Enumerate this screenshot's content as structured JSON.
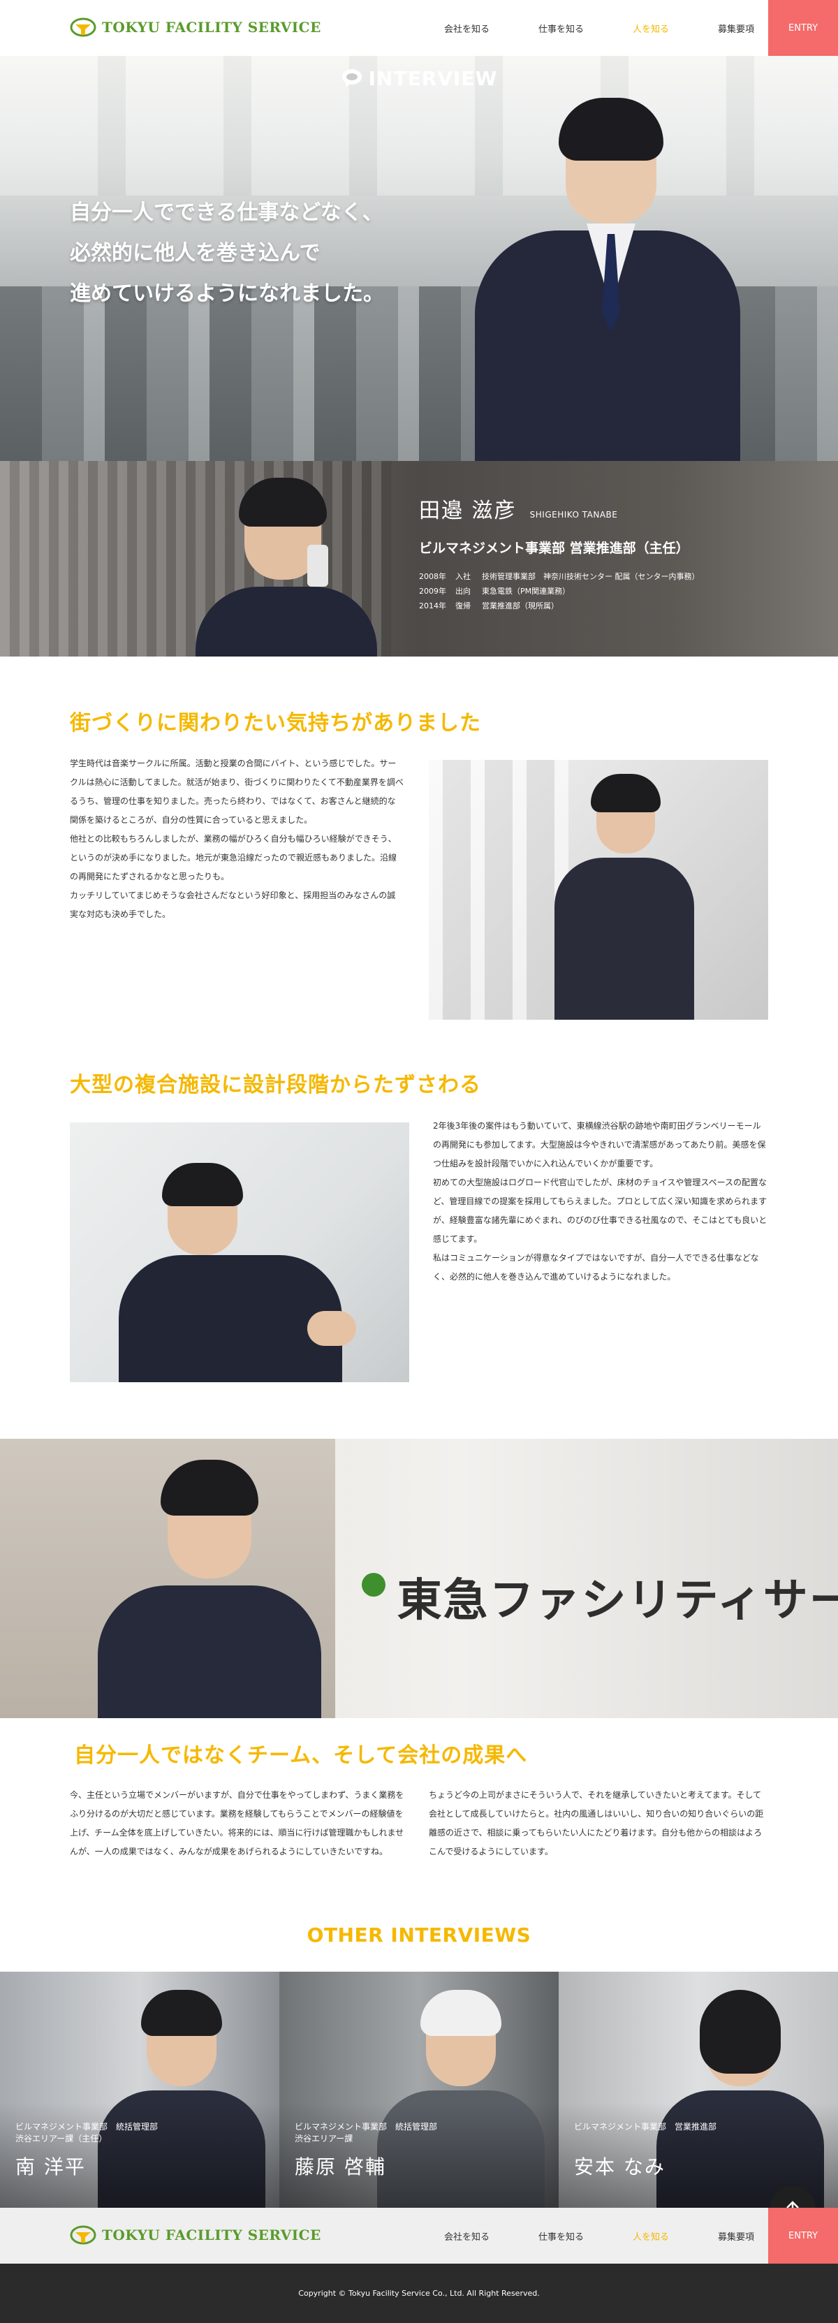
{
  "header": {
    "logo_text": "TOKYU FACILITY SERVICE",
    "nav": [
      "会社を知る",
      "仕事を知る",
      "人を知る",
      "募集要項"
    ],
    "active_nav": "人を知る",
    "entry_label": "ENTRY"
  },
  "hero": {
    "label": "INTERVIEW",
    "copy_lines": [
      "自分一人でできる仕事などなく、",
      "必然的に他人を巻き込んで",
      "進めていけるようになれました。"
    ]
  },
  "profile": {
    "name": "田邉 滋彦",
    "roman": "SHIGEHIKO TANABE",
    "dept": "ビルマネジメント事業部 営業推進部（主任）",
    "history": [
      {
        "year": "2008年",
        "kind": "入社",
        "detail": "技術管理事業部　神奈川技術センター 配属（センター内事務）"
      },
      {
        "year": "2009年",
        "kind": "出向",
        "detail": "東急電鉄（PM関連業務）"
      },
      {
        "year": "2014年",
        "kind": "復帰",
        "detail": "営業推進部（現所属）"
      }
    ]
  },
  "section1": {
    "heading": "街づくりに関わりたい気持ちがありました",
    "paragraphs": [
      "学生時代は音楽サークルに所属。活動と授業の合間にバイト、という感じでした。サークルは熱心に活動してました。就活が始まり、街づくりに関わりたくて不動産業界を調べるうち、管理の仕事を知りました。売ったら終わり、ではなくて、お客さんと継続的な関係を築けるところが、自分の性質に合っていると思えました。",
      "他社との比較もちろんしましたが、業務の幅がひろく自分も幅ひろい経験ができそう、というのが決め手になりました。地元が東急沿線だったので親近感もありました。沿線の再開発にたずされるかなと思ったりも。",
      "カッチリしていてまじめそうな会社さんだなという好印象と、採用担当のみなさんの誠実な対応も決め手でした。"
    ]
  },
  "section2": {
    "heading": "大型の複合施設に設計段階からたずさわる",
    "paragraphs": [
      "2年後3年後の案件はもう動いていて、東横線渋谷駅の跡地や南町田グランベリーモールの再開発にも参加してます。大型施設は今やきれいで清潔感があってあたり前。美感を保つ仕組みを設計段階でいかに入れ込んでいくかが重要です。",
      "初めての大型施設はログロード代官山でしたが、床材のチョイスや管理スペースの配置など、管理目線での提案を採用してもらえました。プロとして広く深い知識を求められますが、経験豊富な諸先輩にめぐまれ、のびのび仕事できる社風なので、そこはとても良いと感じてます。",
      "私はコミュニケーションが得意なタイプではないですが、自分一人でできる仕事などなく、必然的に他人を巻き込んで進めていけるようになれました。"
    ]
  },
  "section3": {
    "sign": "東急ファシリティサービス株式会社",
    "heading": "自分一人ではなくチーム、そして会社の成果へ",
    "col1": "今、主任という立場でメンバーがいますが、自分で仕事をやってしまわず、うまく業務をふり分けるのが大切だと感じています。業務を経験してもらうことでメンバーの経験値を上げ、チーム全体を底上げしていきたい。将来的には、順当に行けば管理職かもしれませんが、一人の成果ではなく、みんなが成果をあげられるようにしていきたいですね。",
    "col2": "ちょうど今の上司がまさにそういう人で、それを継承していきたいと考えてます。そして会社として成長していけたらと。社内の風通しはいいし、知り合いの知り合いぐらいの距離感の近さで、相談に乗ってもらいたい人にたどり着けます。自分も他からの相談はよろこんで受けるようにしています。"
  },
  "other": {
    "title": "OTHER INTERVIEWS",
    "cards": [
      {
        "dept": "ビルマネジメント事業部　統括管理部\n渋谷エリアー課（主任）",
        "name": "南 洋平"
      },
      {
        "dept": "ビルマネジメント事業部　統括管理部\n渋谷エリアー課",
        "name": "藤原 啓輔"
      },
      {
        "dept": "ビルマネジメント事業部　営業推進部",
        "name": "安本 なみ"
      }
    ]
  },
  "footer": {
    "copyright": "Copyright © Tokyu Facility Service Co., Ltd. All Right Reserved."
  },
  "colors": {
    "accent": "#f5b800",
    "entry": "#f56a6a",
    "brand_green": "#5a9b2c"
  }
}
